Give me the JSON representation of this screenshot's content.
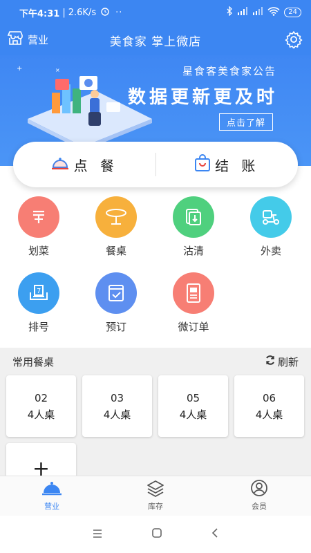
{
  "status_bar": {
    "time": "下午4:31",
    "speed": "2.6K/s",
    "dots": "··",
    "battery": "24"
  },
  "header": {
    "business_label": "营业",
    "title": "美食家 掌上微店"
  },
  "banner": {
    "subtitle": "星食客美食家公告",
    "headline": "数据更新更及时",
    "button": "点击了解"
  },
  "actions": {
    "order": "点 餐",
    "checkout": "结 账"
  },
  "grid": [
    {
      "label": "划菜",
      "color": "#f77e74",
      "icon": "dish-icon"
    },
    {
      "label": "餐桌",
      "color": "#f7b03c",
      "icon": "table-icon"
    },
    {
      "label": "沽清",
      "color": "#4fd07e",
      "icon": "sold-out-icon"
    },
    {
      "label": "外卖",
      "color": "#44cbe9",
      "icon": "scooter-icon"
    },
    {
      "label": "排号",
      "color": "#3c9ff0",
      "icon": "queue-icon"
    },
    {
      "label": "预订",
      "color": "#5e8ff0",
      "icon": "reserve-icon"
    },
    {
      "label": "微订单",
      "color": "#f77e74",
      "icon": "micro-order-icon"
    }
  ],
  "tables": {
    "title": "常用餐桌",
    "refresh": "刷新",
    "items": [
      {
        "number": "02",
        "size": "4人桌"
      },
      {
        "number": "03",
        "size": "4人桌"
      },
      {
        "number": "05",
        "size": "4人桌"
      },
      {
        "number": "06",
        "size": "4人桌"
      }
    ],
    "add": "+"
  },
  "bottom_nav": [
    {
      "label": "营业",
      "active": true
    },
    {
      "label": "库存",
      "active": false
    },
    {
      "label": "会员",
      "active": false
    }
  ],
  "colors": {
    "primary": "#3c86f2",
    "checkout_accent": "#e8413a"
  }
}
